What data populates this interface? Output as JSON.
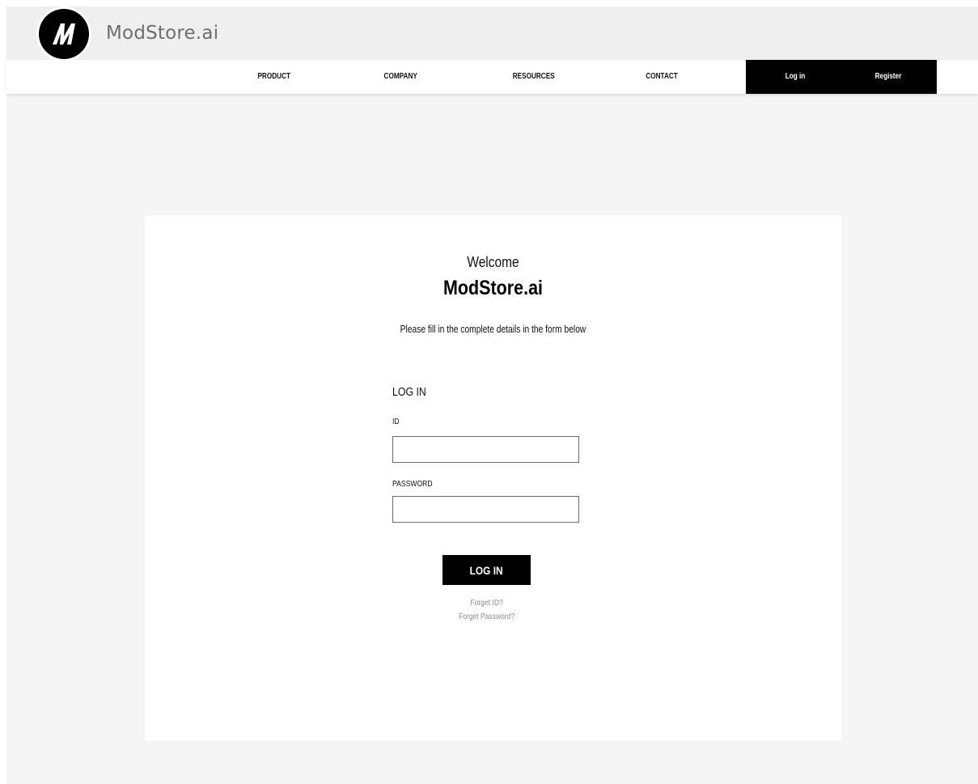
{
  "header": {
    "brand_name": "ModStore.ai",
    "logo_icon": "modstore-m-logo"
  },
  "nav": {
    "items": [
      "PRODUCT",
      "COMPANY",
      "RESOURCES",
      "CONTACT"
    ],
    "login_label": "Log in",
    "register_label": "Register"
  },
  "card": {
    "welcome": "Welcome",
    "title": "ModStore.ai",
    "subtitle": "Please fill in the complete details in the form below"
  },
  "form": {
    "heading": "LOG IN",
    "id_label": "ID",
    "id_value": "",
    "password_label": "PASSWORD",
    "password_value": "",
    "submit_label": "LOG IN",
    "forgot_id": "Forget ID?",
    "forgot_password": "Forget Password?"
  },
  "colors": {
    "accent": "#000000",
    "page_background": "#f5f5f5",
    "link_gray": "#8a8a8a"
  }
}
